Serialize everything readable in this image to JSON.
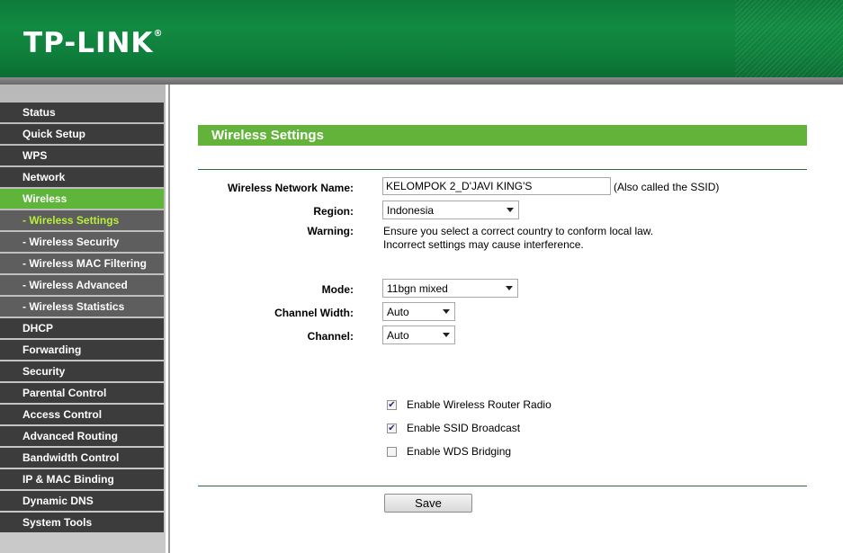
{
  "header": {
    "brand": "TP-LINK",
    "brand_mark": "®"
  },
  "sidebar": {
    "items": [
      {
        "label": "Status",
        "type": "main"
      },
      {
        "label": "Quick Setup",
        "type": "main"
      },
      {
        "label": "WPS",
        "type": "main"
      },
      {
        "label": "Network",
        "type": "main"
      },
      {
        "label": "Wireless",
        "type": "active"
      },
      {
        "label": "- Wireless Settings",
        "type": "sub-current"
      },
      {
        "label": "- Wireless Security",
        "type": "sub"
      },
      {
        "label": "- Wireless MAC Filtering",
        "type": "sub"
      },
      {
        "label": "- Wireless Advanced",
        "type": "sub"
      },
      {
        "label": "- Wireless Statistics",
        "type": "sub"
      },
      {
        "label": "DHCP",
        "type": "main"
      },
      {
        "label": "Forwarding",
        "type": "main"
      },
      {
        "label": "Security",
        "type": "main"
      },
      {
        "label": "Parental Control",
        "type": "main"
      },
      {
        "label": "Access Control",
        "type": "main"
      },
      {
        "label": "Advanced Routing",
        "type": "main"
      },
      {
        "label": "Bandwidth Control",
        "type": "main"
      },
      {
        "label": "IP & MAC Binding",
        "type": "main"
      },
      {
        "label": "Dynamic DNS",
        "type": "main"
      },
      {
        "label": "System Tools",
        "type": "main"
      }
    ]
  },
  "main": {
    "title": "Wireless Settings",
    "ssid": {
      "label": "Wireless Network Name:",
      "value": "KELOMPOK 2_D'JAVI KING'S",
      "note": "(Also called the SSID)"
    },
    "region": {
      "label": "Region:",
      "value": "Indonesia"
    },
    "warning": {
      "label": "Warning:",
      "line1": "Ensure you select a correct country to conform local law.",
      "line2": "Incorrect settings may cause interference."
    },
    "mode": {
      "label": "Mode:",
      "value": "11bgn mixed"
    },
    "channel_width": {
      "label": "Channel Width:",
      "value": "Auto"
    },
    "channel": {
      "label": "Channel:",
      "value": "Auto"
    },
    "options": {
      "radio": {
        "label": "Enable Wireless Router Radio",
        "checked": true
      },
      "ssid_broadcast": {
        "label": "Enable SSID Broadcast",
        "checked": true
      },
      "wds": {
        "label": "Enable WDS Bridging",
        "checked": false
      }
    },
    "save_label": "Save"
  },
  "colors": {
    "header_green": "#128a42",
    "accent_green": "#63b33a",
    "nav_dark": "#3c3c3c",
    "nav_sub": "#5e5e5e",
    "current_sub_text": "#b8f03a"
  }
}
